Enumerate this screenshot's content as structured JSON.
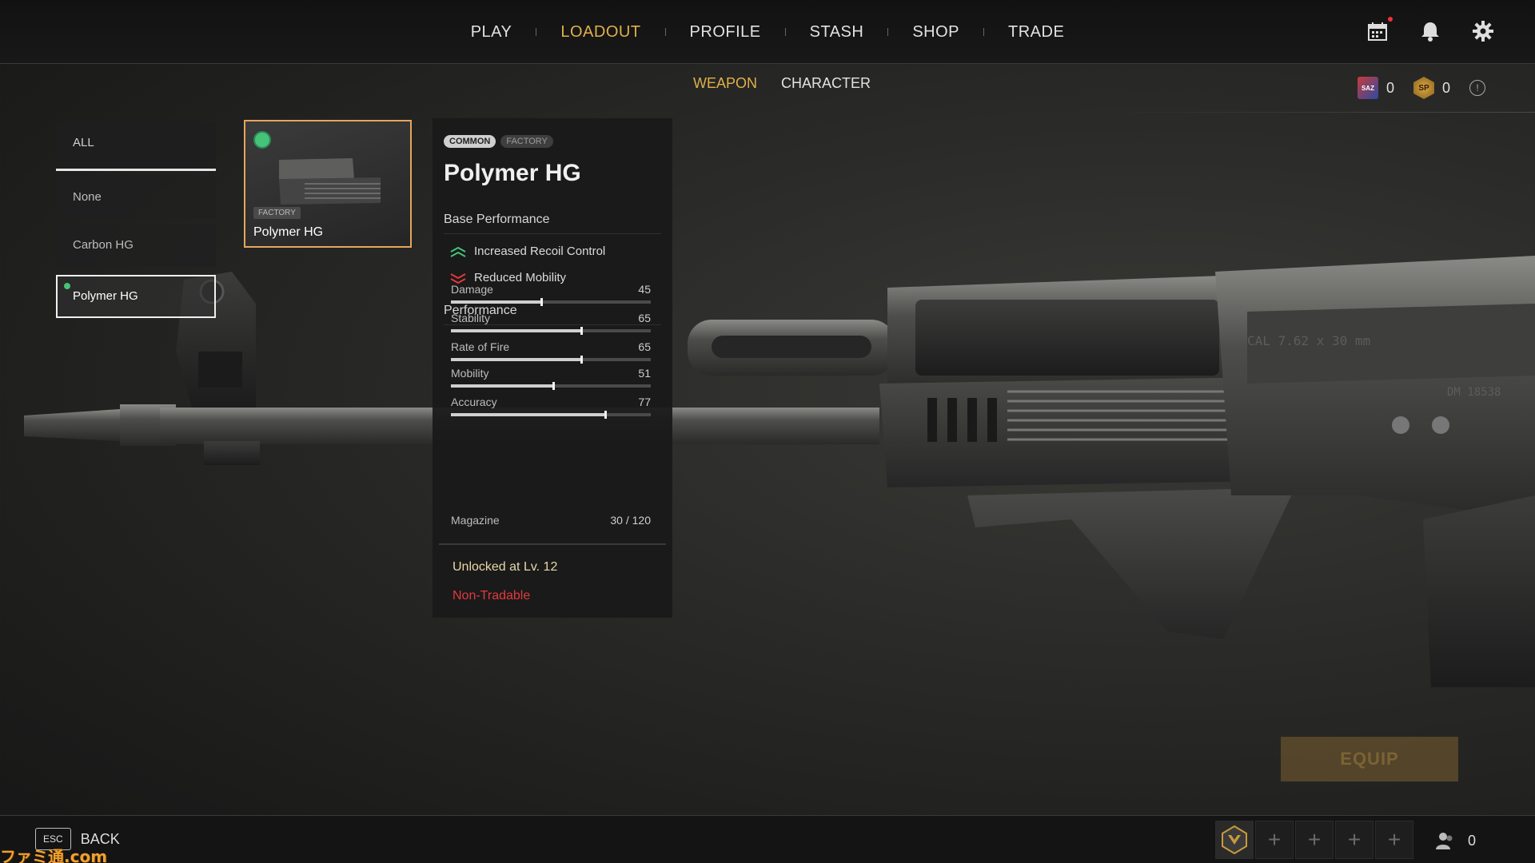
{
  "nav": {
    "items": [
      "PLAY",
      "LOADOUT",
      "PROFILE",
      "STASH",
      "SHOP",
      "TRADE"
    ],
    "active_index": 1
  },
  "top_icons": [
    "calendar-icon",
    "bell-icon",
    "gear-icon"
  ],
  "subtabs": {
    "weapon": "WEAPON",
    "character": "CHARACTER",
    "active": "WEAPON"
  },
  "currencies": {
    "saz": {
      "icon_text": "SAZ",
      "value": "0"
    },
    "sp": {
      "icon_text": "SP",
      "value": "0"
    },
    "info": "!"
  },
  "filter": {
    "all": "ALL",
    "items": [
      "None",
      "Carbon HG",
      "Polymer HG"
    ],
    "selected_index": 2
  },
  "card": {
    "badge": "FACTORY",
    "name": "Polymer HG"
  },
  "detail": {
    "rarity": "COMMON",
    "source": "FACTORY",
    "title": "Polymer HG",
    "base_performance_label": "Base Performance",
    "base_effects": [
      {
        "text": "Increased Recoil Control",
        "kind": "positive"
      },
      {
        "text": "Reduced Mobility",
        "kind": "negative"
      }
    ],
    "performance_label": "Performance",
    "stats": [
      {
        "label": "Damage",
        "value": "45",
        "level": 0.45
      },
      {
        "label": "Stability",
        "value": "65",
        "level": 0.65
      },
      {
        "label": "Rate of Fire",
        "value": "65",
        "level": 0.65
      },
      {
        "label": "Mobility",
        "value": "51",
        "level": 0.51
      },
      {
        "label": "Accuracy",
        "value": "77",
        "level": 0.77
      }
    ],
    "magazine_label": "Magazine",
    "magazine_value": "30 / 120",
    "unlock": "Unlocked at Lv. 12",
    "tradable": "Non-Tradable"
  },
  "weapon_engraving": {
    "caliber": "CAL 7.62 x 30 mm",
    "serial": "DM 18538"
  },
  "equip_label": "EQUIP",
  "bottom": {
    "esc_key": "ESC",
    "back_label": "BACK",
    "party_slots": [
      "+",
      "+",
      "+",
      "+"
    ],
    "friends_count": "0"
  },
  "watermark": "ファミ通.com",
  "colors": {
    "accent": "#e0b04a",
    "selected_border": "#e8a55a",
    "positive": "#45c378",
    "negative": "#e3393d"
  }
}
